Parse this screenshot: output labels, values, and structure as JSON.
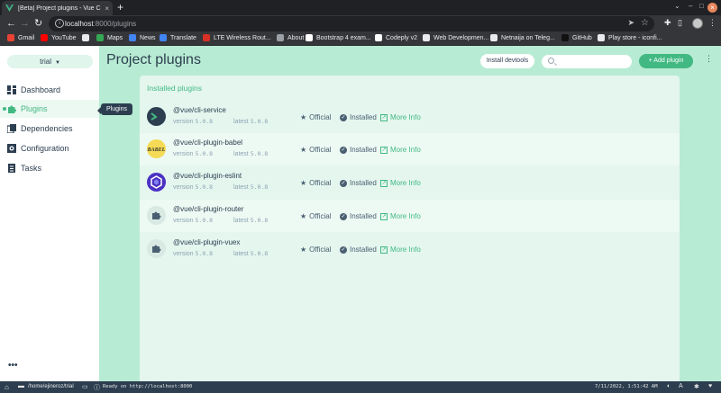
{
  "browser": {
    "tab_title": "[Beta] Project plugins - Vue C",
    "tab_close": "×",
    "new_tab": "+",
    "url_host": "localhost",
    "url_rest": ":8000/plugins",
    "bookmarks": [
      {
        "label": "Gmail",
        "color": "#ea4335"
      },
      {
        "label": "YouTube",
        "color": "#ff0000"
      },
      {
        "label": "",
        "color": "#e8eaed"
      },
      {
        "label": "Maps",
        "color": "#34a853"
      },
      {
        "label": "News",
        "color": "#4285f4"
      },
      {
        "label": "Translate",
        "color": "#4285f4"
      },
      {
        "label": "LTE Wireless Rout...",
        "color": "#d93025"
      },
      {
        "label": "About",
        "color": "#9aa0a6"
      },
      {
        "label": "Bootstrap 4 exam...",
        "color": "#ffffff"
      },
      {
        "label": "Codeply v2",
        "color": "#ffffff"
      },
      {
        "label": "Web Developmen...",
        "color": "#e8eaed"
      },
      {
        "label": "Netnaija on Teleg...",
        "color": "#e8eaed"
      },
      {
        "label": "GitHub",
        "color": "#111111"
      },
      {
        "label": "Play store - iconfi...",
        "color": "#e8eaed"
      }
    ]
  },
  "sidebar": {
    "project": "trial",
    "items": [
      {
        "label": "Dashboard",
        "icon": "dashboard-icon"
      },
      {
        "label": "Plugins",
        "icon": "puzzle-icon"
      },
      {
        "label": "Dependencies",
        "icon": "dependencies-icon"
      },
      {
        "label": "Configuration",
        "icon": "gear-icon"
      },
      {
        "label": "Tasks",
        "icon": "tasks-icon"
      }
    ],
    "tooltip": "Plugins",
    "more": "•••"
  },
  "header": {
    "title": "Project plugins",
    "install_devtools": "Install devtools",
    "search_placeholder": "",
    "add_plugin": "+ Add plugin",
    "menu": "⋮"
  },
  "panel": {
    "title": "Installed plugins",
    "version_label": "version",
    "latest_label": "latest",
    "official_label": "Official",
    "installed_label": "Installed",
    "more_info_label": "More Info",
    "plugins": [
      {
        "name": "@vue/cli-service",
        "version": "5.0.8",
        "latest": "5.0.8",
        "logo": "vue-cli-logo"
      },
      {
        "name": "@vue/cli-plugin-babel",
        "version": "5.0.8",
        "latest": "5.0.8",
        "logo": "babel-logo"
      },
      {
        "name": "@vue/cli-plugin-eslint",
        "version": "5.0.8",
        "latest": "5.0.8",
        "logo": "eslint-logo"
      },
      {
        "name": "@vue/cli-plugin-router",
        "version": "5.0.8",
        "latest": "5.0.8",
        "logo": "puzzle-logo"
      },
      {
        "name": "@vue/cli-plugin-vuex",
        "version": "5.0.8",
        "latest": "5.0.8",
        "logo": "puzzle-logo"
      }
    ]
  },
  "statusbar": {
    "path": "/home/ejineroz/trial",
    "status": "Ready on http://localhost:8000",
    "datetime": "7/11/2022, 1:51:42 AM"
  },
  "colors": {
    "accent": "#42b983",
    "text": "#2c3e50",
    "app_bg": "#b8ebd3",
    "panel_bg": "#e4f6ee"
  }
}
